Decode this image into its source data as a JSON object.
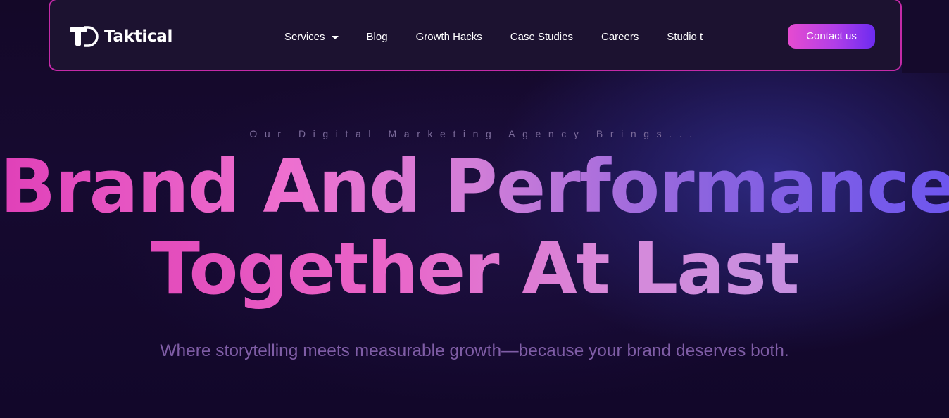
{
  "brand": {
    "name": "Taktical"
  },
  "nav": {
    "items": [
      {
        "label": "Services",
        "has_dropdown": true
      },
      {
        "label": "Blog"
      },
      {
        "label": "Growth Hacks"
      },
      {
        "label": "Case Studies"
      },
      {
        "label": "Careers"
      },
      {
        "label": "Studio t"
      }
    ],
    "cta_label": "Contact us"
  },
  "hero": {
    "eyebrow": "Our Digital Marketing Agency Brings...",
    "headline_line1": "Brand And Performance",
    "headline_line2": "Together At Last",
    "subheadline": "Where storytelling meets measurable growth—because your brand deserves both."
  },
  "colors": {
    "background": "#130826",
    "navbar_border": "#c42aa8",
    "accent_pink": "#e64bd0",
    "accent_purple": "#6c2bf0",
    "subheadline": "#7f5da6"
  },
  "icons": {
    "logo": "taktical-logo-icon",
    "dropdown": "chevron-down-icon"
  }
}
